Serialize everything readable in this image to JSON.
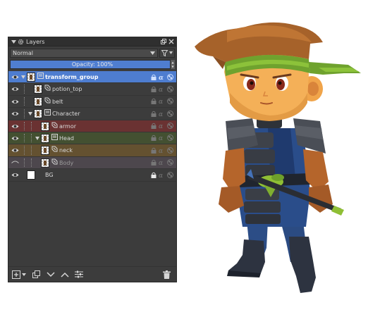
{
  "panel": {
    "title": "Layers",
    "blend_mode": "Normal",
    "opacity_label": "Opacity:  100%",
    "opacity_value": 1.0
  },
  "layers": [
    {
      "name": "transform_group",
      "depth": 0,
      "type": "group",
      "selected": true,
      "visible": true,
      "color_label": "selected"
    },
    {
      "name": "potion_top",
      "depth": 1,
      "type": "transform",
      "visible": true,
      "color_label": "none"
    },
    {
      "name": "belt",
      "depth": 1,
      "type": "transform",
      "visible": true,
      "color_label": "none"
    },
    {
      "name": "Character",
      "depth": 1,
      "type": "group",
      "visible": true,
      "color_label": "none"
    },
    {
      "name": "armor",
      "depth": 2,
      "type": "transform",
      "visible": true,
      "color_label": "red"
    },
    {
      "name": "Head",
      "depth": 2,
      "type": "group",
      "visible": true,
      "color_label": "green"
    },
    {
      "name": "neck",
      "depth": 2,
      "type": "transform",
      "visible": true,
      "color_label": "orange"
    },
    {
      "name": "Body",
      "depth": 2,
      "type": "transform",
      "visible": false,
      "color_label": "gray"
    },
    {
      "name": "BG",
      "depth": 0,
      "type": "paint",
      "visible": true,
      "locked": true,
      "color_label": "none"
    }
  ],
  "colors": {
    "panel_bg": "#3c3c3c",
    "selection": "#4e7dd0",
    "label_red": "#6a3232",
    "label_green": "#435031",
    "label_orange": "#645130",
    "label_gray": "#4d474d"
  },
  "icons": {
    "titlebar": [
      "collapse-arrow-icon",
      "gear-icon",
      "float-icon",
      "close-icon"
    ],
    "toolbar": [
      "dropdown-arrow-icon",
      "filter-icon",
      "chevron-down-icon"
    ],
    "layer_props": [
      "lock-icon",
      "alpha-lock-icon",
      "inherit-alpha-icon"
    ],
    "bottombar": [
      "add-layer-icon",
      "dropdown-arrow-icon",
      "duplicate-icon",
      "move-down-icon",
      "move-up-icon",
      "properties-icon",
      "delete-icon"
    ]
  }
}
